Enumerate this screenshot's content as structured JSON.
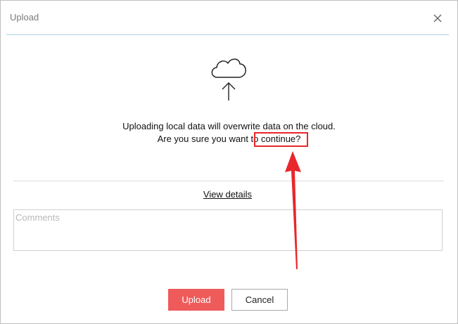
{
  "dialog": {
    "title": "Upload",
    "close_icon": "close-icon",
    "upload_icon": "cloud-upload-icon",
    "message_line1": "Uploading local data will overwrite data on the cloud.",
    "message_line2": "Are you sure you want to continue?",
    "view_details_label": "View details",
    "comments_placeholder": "Comments",
    "comments_value": "",
    "upload_button_label": "Upload",
    "cancel_button_label": "Cancel"
  },
  "annotation": {
    "highlight_color": "#e8262b",
    "arrow_color": "#e8262b"
  },
  "colors": {
    "upload_button": "#ef5a5a",
    "header_rule": "#a9d4e6"
  }
}
